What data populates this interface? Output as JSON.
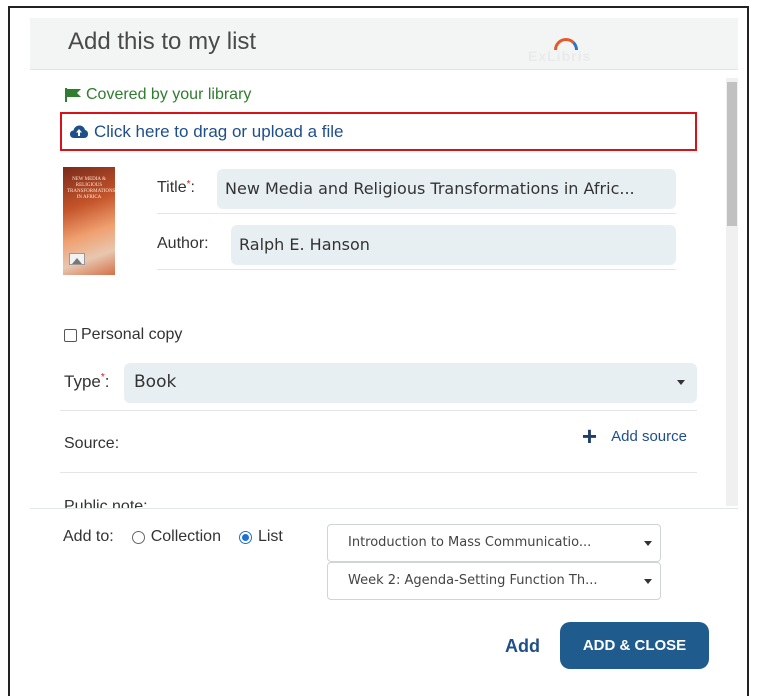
{
  "dialog": {
    "title": "Add this to my list",
    "brand_wordmark": "ExLibris"
  },
  "form": {
    "covered_text": "Covered by your library",
    "upload_text": "Click here to drag or upload a file",
    "cover_title": "NEW MEDIA & RELIGIOUS TRANSFORMATIONS IN AFRICA",
    "title_label": "Title",
    "title_value": "New Media and Religious Transformations in Afric...",
    "author_label": "Author:",
    "author_value": "Ralph E. Hanson",
    "personal_copy_label": "Personal copy",
    "type_label": "Type",
    "type_value": "Book",
    "source_label": "Source:",
    "add_source_label": "Add source",
    "public_note_label": "Public note:"
  },
  "footer": {
    "add_to_label": "Add to:",
    "option_collection": "Collection",
    "option_list": "List",
    "selected_option": "List",
    "list_dropdown_value": "Introduction to Mass Communicatio...",
    "section_dropdown_value": "Week 2: Agenda-Setting Function Th...",
    "add_button": "Add",
    "add_close_button": "ADD & CLOSE"
  },
  "colors": {
    "accent": "#205b8d",
    "link": "#1f4f8a",
    "covered_green": "#2f7d2f",
    "highlight_red": "#d9121a",
    "field_bg": "#e7eff3"
  }
}
